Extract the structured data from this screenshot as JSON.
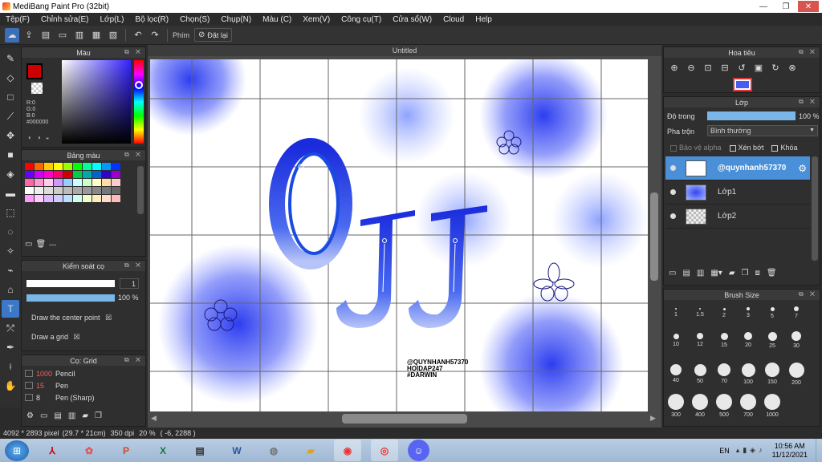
{
  "window": {
    "title": "MediBang Paint Pro (32bit)"
  },
  "menu": [
    "Tệp(F)",
    "Chỉnh sửa(E)",
    "Lớp(L)",
    "Bộ lọc(R)",
    "Chọn(S)",
    "Chụp(N)",
    "Màu (C)",
    "Xem(V)",
    "Công cụ(T)",
    "Cửa sổ(W)",
    "Cloud",
    "Help"
  ],
  "toolbar": {
    "key_label": "Phím",
    "reset_label": "Đặt lại"
  },
  "color_panel": {
    "title": "Màu",
    "r": "R:0",
    "g": "G:0",
    "b": "B:0",
    "hex": "#000000"
  },
  "palette_panel": {
    "title": "Bảng màu",
    "footer_text": "---"
  },
  "brush_control": {
    "title": "Kiểm soát cọ",
    "size_value": "1",
    "opacity_value": "100 %",
    "option1": "Draw the center point",
    "option2": "Draw a grid"
  },
  "brush_list": {
    "title": "Cọ: Grid",
    "items": [
      {
        "size": "1000",
        "name": "Pencil"
      },
      {
        "size": "15",
        "name": "Pen"
      },
      {
        "size": "8",
        "name": "Pen (Sharp)"
      }
    ]
  },
  "document": {
    "tab_title": "Untitled",
    "watermark": [
      "@QUYNHANH57370",
      "HOIDAP247",
      "#DARWIN"
    ],
    "art_text": "OJJ"
  },
  "navigator": {
    "title": "Hoa tiêu"
  },
  "layer_panel": {
    "title": "Lớp",
    "opacity_label": "Độ trong",
    "opacity_value": "100 %",
    "blend_label": "Pha trộn",
    "blend_value": "Bình thường",
    "protect_alpha": "Bảo vệ alpha",
    "clipping": "Xén bớt",
    "lock": "Khóa",
    "layers": [
      {
        "name": "@quynhanh57370",
        "selected": true
      },
      {
        "name": "Lớp1",
        "selected": false
      },
      {
        "name": "Lớp2",
        "selected": false
      }
    ]
  },
  "brush_size": {
    "title": "Brush Size",
    "sizes": [
      "1",
      "1.5",
      "2",
      "3",
      "5",
      "7",
      "10",
      "12",
      "15",
      "20",
      "25",
      "30",
      "40",
      "50",
      "70",
      "100",
      "150",
      "200",
      "300",
      "400",
      "500",
      "700",
      "1000"
    ]
  },
  "status": {
    "dimensions": "4092 * 2893 pixel",
    "physical": "(29.7 * 21cm)",
    "dpi": "350 dpi",
    "zoom": "20 %",
    "coords": "( -6, 2288 )"
  },
  "taskbar": {
    "lang": "EN",
    "time": "10:56 AM",
    "date": "11/12/2021"
  },
  "colors": {
    "accent": "#3b78c8",
    "primary": "#cc0000",
    "layer_selected": "#4a90d9"
  }
}
